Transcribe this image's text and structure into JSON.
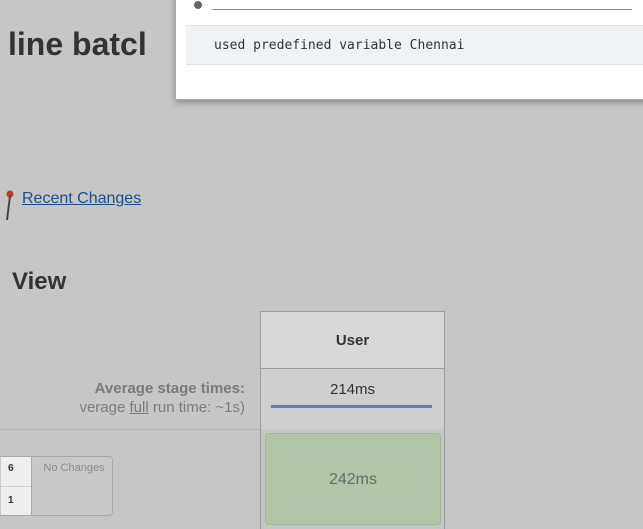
{
  "header": {
    "title": "line batcl"
  },
  "console_popup": {
    "log_line": "used predefined variable Chennai"
  },
  "links": {
    "recent_changes": "Recent Changes"
  },
  "stage_view": {
    "title": "View",
    "average_stage_times_label": "Average stage times:",
    "average_full_run_prefix": "verage ",
    "average_full_run_word": "full",
    "average_full_run_suffix": " run time: ~1s)",
    "columns": [
      {
        "header": "User",
        "average": "214ms"
      }
    ],
    "builds": [
      {
        "number_top": "6",
        "number_bottom": "1",
        "changes": "No Changes",
        "stage_times": [
          "242ms"
        ]
      }
    ]
  },
  "colors": {
    "background": "#c6c6c6",
    "stage_success": "#b2c5a8",
    "avg_bar": "#5b7fb0",
    "link": "#1a4e8f"
  },
  "icons": {
    "recent_changes": "pushpin-icon"
  }
}
